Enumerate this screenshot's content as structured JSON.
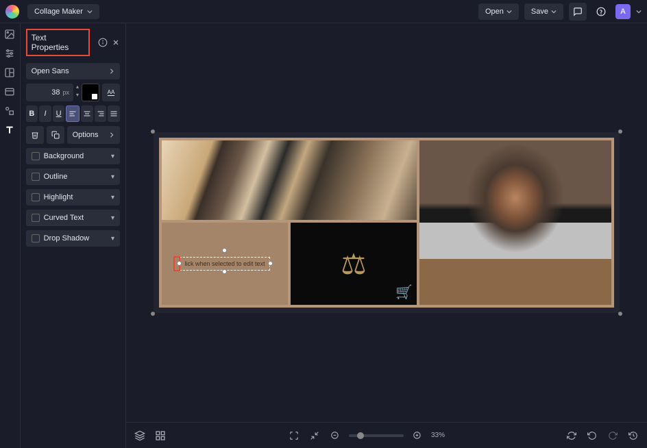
{
  "header": {
    "app_title": "Collage Maker",
    "open": "Open",
    "save": "Save",
    "avatar": "A"
  },
  "panel": {
    "title": "Text Properties",
    "font": "Open Sans",
    "size": "38",
    "size_unit": "px",
    "caps": "AA",
    "options": "Options",
    "accordion": [
      "Background",
      "Outline",
      "Highlight",
      "Curved Text",
      "Drop Shadow"
    ]
  },
  "canvas": {
    "text_placeholder": "lick when selected to edit text"
  },
  "bottombar": {
    "zoom": "33%"
  }
}
